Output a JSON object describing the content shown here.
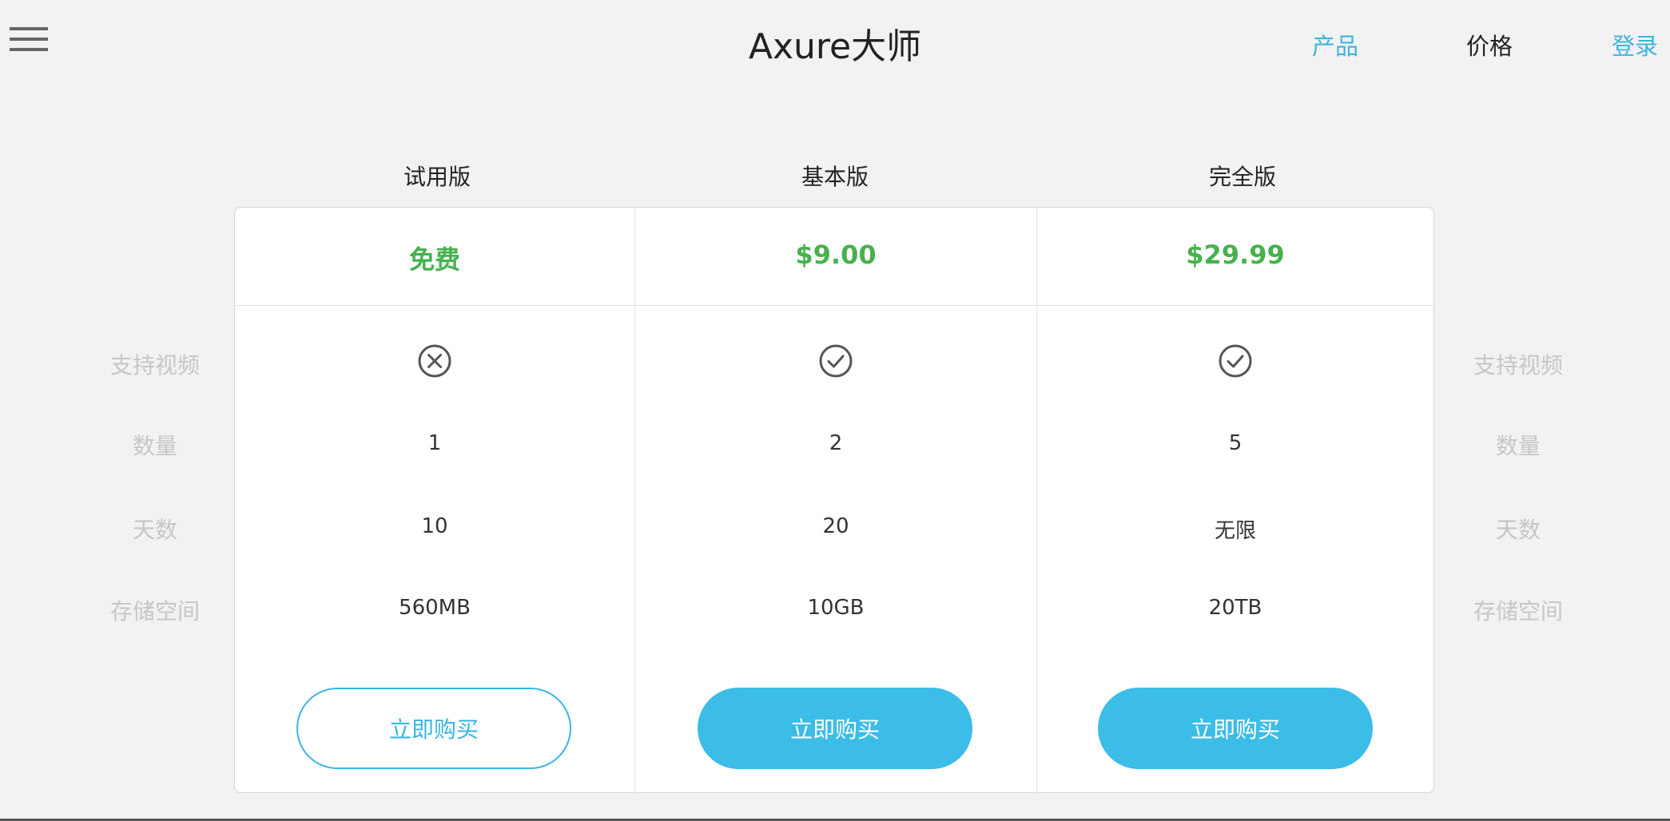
{
  "header": {
    "title": "Axure大师",
    "nav": [
      {
        "label": "产品",
        "color": "#3cb4e0"
      },
      {
        "label": "价格",
        "color": "#222222"
      },
      {
        "label": "登录",
        "color": "#3cb4e0"
      }
    ]
  },
  "feature_labels": [
    "支持视频",
    "数量",
    "天数",
    "存储空间"
  ],
  "plans": [
    {
      "name": "试用版",
      "price": "免费",
      "video": "cross-circle-icon",
      "quantity": "1",
      "days": "10",
      "storage": "560MB",
      "buy_label": "立即购买",
      "button_style": "outline"
    },
    {
      "name": "基本版",
      "price": "$9.00",
      "video": "check-circle-icon",
      "quantity": "2",
      "days": "20",
      "storage": "10GB",
      "buy_label": "立即购买",
      "button_style": "filled"
    },
    {
      "name": "完全版",
      "price": "$29.99",
      "video": "check-circle-icon",
      "quantity": "5",
      "days": "无限",
      "storage": "20TB",
      "buy_label": "立即购买",
      "button_style": "filled"
    }
  ],
  "colors": {
    "accent": "#3bbde8",
    "price": "#46b24b",
    "muted_label": "#c6c6c6"
  }
}
